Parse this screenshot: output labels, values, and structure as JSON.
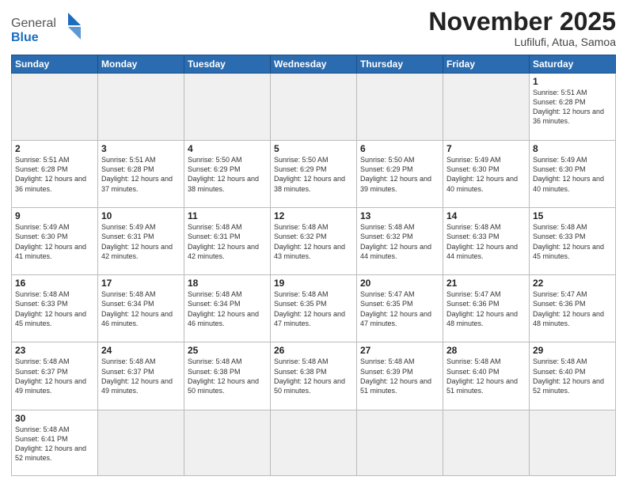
{
  "header": {
    "logo_general": "General",
    "logo_blue": "Blue",
    "month_title": "November 2025",
    "subtitle": "Lufilufi, Atua, Samoa"
  },
  "weekdays": [
    "Sunday",
    "Monday",
    "Tuesday",
    "Wednesday",
    "Thursday",
    "Friday",
    "Saturday"
  ],
  "weeks": [
    [
      {
        "day": "",
        "info": "",
        "empty": true
      },
      {
        "day": "",
        "info": "",
        "empty": true
      },
      {
        "day": "",
        "info": "",
        "empty": true
      },
      {
        "day": "",
        "info": "",
        "empty": true
      },
      {
        "day": "",
        "info": "",
        "empty": true
      },
      {
        "day": "",
        "info": "",
        "empty": true
      },
      {
        "day": "1",
        "info": "Sunrise: 5:51 AM\nSunset: 6:28 PM\nDaylight: 12 hours\nand 36 minutes."
      }
    ],
    [
      {
        "day": "2",
        "info": "Sunrise: 5:51 AM\nSunset: 6:28 PM\nDaylight: 12 hours\nand 36 minutes."
      },
      {
        "day": "3",
        "info": "Sunrise: 5:51 AM\nSunset: 6:28 PM\nDaylight: 12 hours\nand 37 minutes."
      },
      {
        "day": "4",
        "info": "Sunrise: 5:50 AM\nSunset: 6:29 PM\nDaylight: 12 hours\nand 38 minutes."
      },
      {
        "day": "5",
        "info": "Sunrise: 5:50 AM\nSunset: 6:29 PM\nDaylight: 12 hours\nand 38 minutes."
      },
      {
        "day": "6",
        "info": "Sunrise: 5:50 AM\nSunset: 6:29 PM\nDaylight: 12 hours\nand 39 minutes."
      },
      {
        "day": "7",
        "info": "Sunrise: 5:49 AM\nSunset: 6:30 PM\nDaylight: 12 hours\nand 40 minutes."
      },
      {
        "day": "8",
        "info": "Sunrise: 5:49 AM\nSunset: 6:30 PM\nDaylight: 12 hours\nand 40 minutes."
      }
    ],
    [
      {
        "day": "9",
        "info": "Sunrise: 5:49 AM\nSunset: 6:30 PM\nDaylight: 12 hours\nand 41 minutes."
      },
      {
        "day": "10",
        "info": "Sunrise: 5:49 AM\nSunset: 6:31 PM\nDaylight: 12 hours\nand 42 minutes."
      },
      {
        "day": "11",
        "info": "Sunrise: 5:48 AM\nSunset: 6:31 PM\nDaylight: 12 hours\nand 42 minutes."
      },
      {
        "day": "12",
        "info": "Sunrise: 5:48 AM\nSunset: 6:32 PM\nDaylight: 12 hours\nand 43 minutes."
      },
      {
        "day": "13",
        "info": "Sunrise: 5:48 AM\nSunset: 6:32 PM\nDaylight: 12 hours\nand 44 minutes."
      },
      {
        "day": "14",
        "info": "Sunrise: 5:48 AM\nSunset: 6:33 PM\nDaylight: 12 hours\nand 44 minutes."
      },
      {
        "day": "15",
        "info": "Sunrise: 5:48 AM\nSunset: 6:33 PM\nDaylight: 12 hours\nand 45 minutes."
      }
    ],
    [
      {
        "day": "16",
        "info": "Sunrise: 5:48 AM\nSunset: 6:33 PM\nDaylight: 12 hours\nand 45 minutes."
      },
      {
        "day": "17",
        "info": "Sunrise: 5:48 AM\nSunset: 6:34 PM\nDaylight: 12 hours\nand 46 minutes."
      },
      {
        "day": "18",
        "info": "Sunrise: 5:48 AM\nSunset: 6:34 PM\nDaylight: 12 hours\nand 46 minutes."
      },
      {
        "day": "19",
        "info": "Sunrise: 5:48 AM\nSunset: 6:35 PM\nDaylight: 12 hours\nand 47 minutes."
      },
      {
        "day": "20",
        "info": "Sunrise: 5:47 AM\nSunset: 6:35 PM\nDaylight: 12 hours\nand 47 minutes."
      },
      {
        "day": "21",
        "info": "Sunrise: 5:47 AM\nSunset: 6:36 PM\nDaylight: 12 hours\nand 48 minutes."
      },
      {
        "day": "22",
        "info": "Sunrise: 5:47 AM\nSunset: 6:36 PM\nDaylight: 12 hours\nand 48 minutes."
      }
    ],
    [
      {
        "day": "23",
        "info": "Sunrise: 5:48 AM\nSunset: 6:37 PM\nDaylight: 12 hours\nand 49 minutes."
      },
      {
        "day": "24",
        "info": "Sunrise: 5:48 AM\nSunset: 6:37 PM\nDaylight: 12 hours\nand 49 minutes."
      },
      {
        "day": "25",
        "info": "Sunrise: 5:48 AM\nSunset: 6:38 PM\nDaylight: 12 hours\nand 50 minutes."
      },
      {
        "day": "26",
        "info": "Sunrise: 5:48 AM\nSunset: 6:38 PM\nDaylight: 12 hours\nand 50 minutes."
      },
      {
        "day": "27",
        "info": "Sunrise: 5:48 AM\nSunset: 6:39 PM\nDaylight: 12 hours\nand 51 minutes."
      },
      {
        "day": "28",
        "info": "Sunrise: 5:48 AM\nSunset: 6:40 PM\nDaylight: 12 hours\nand 51 minutes."
      },
      {
        "day": "29",
        "info": "Sunrise: 5:48 AM\nSunset: 6:40 PM\nDaylight: 12 hours\nand 52 minutes."
      }
    ],
    [
      {
        "day": "30",
        "info": "Sunrise: 5:48 AM\nSunset: 6:41 PM\nDaylight: 12 hours\nand 52 minutes."
      },
      {
        "day": "",
        "info": "",
        "empty": true
      },
      {
        "day": "",
        "info": "",
        "empty": true
      },
      {
        "day": "",
        "info": "",
        "empty": true
      },
      {
        "day": "",
        "info": "",
        "empty": true
      },
      {
        "day": "",
        "info": "",
        "empty": true
      },
      {
        "day": "",
        "info": "",
        "empty": true
      }
    ]
  ]
}
